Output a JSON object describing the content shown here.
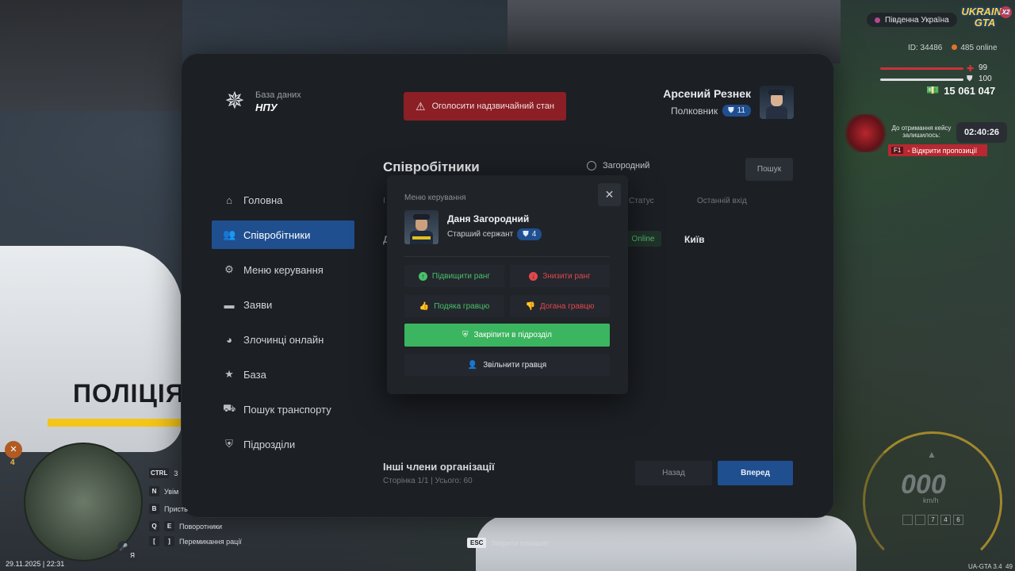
{
  "tablet": {
    "brand_sub": "База даних",
    "brand_title": "НПУ",
    "emergency_label": "Оголосити надзвичайний стан",
    "user": {
      "name": "Арсений Резнек",
      "rank": "Полковник",
      "rank_level": "11"
    }
  },
  "sidebar": {
    "items": [
      {
        "label": "Головна",
        "icon": "home-icon",
        "active": false
      },
      {
        "label": "Співробітники",
        "icon": "users-icon",
        "active": true
      },
      {
        "label": "Меню керування",
        "icon": "gear-icon",
        "active": false
      },
      {
        "label": "Заяви",
        "icon": "folder-icon",
        "active": false
      },
      {
        "label": "Злочинці онлайн",
        "icon": "mask-icon",
        "active": false
      },
      {
        "label": "База",
        "icon": "star-icon",
        "active": false
      },
      {
        "label": "Пошук транспорту",
        "icon": "car-icon",
        "active": false
      },
      {
        "label": "Підрозділи",
        "icon": "shield-icon",
        "active": false
      }
    ]
  },
  "content": {
    "title": "Співробітники",
    "search_value": "Загородний",
    "search_button": "Пошук",
    "columns": {
      "first": "І",
      "status": "Статус",
      "last_login": "Останній вхід"
    },
    "row": {
      "first": "Д",
      "status": "Online",
      "city": "Київ"
    },
    "other_title": "Інші члени організації",
    "other_sub": "Сторінка 1/1 | Усього: 60",
    "back_label": "Назад",
    "next_label": "Вперед"
  },
  "modal": {
    "label": "Меню керування",
    "name": "Даня Загородний",
    "rank": "Старший сержант",
    "rank_level": "4",
    "promote": "Підвищити ранг",
    "demote": "Знизити ранг",
    "thanks": "Подяка гравцю",
    "reprimand": "Догана гравцю",
    "assign": "Закріпити в підрозділ",
    "fire": "Звільнити гравця"
  },
  "hud": {
    "region": "Південна Україна",
    "logo": "UKRAINE GTA",
    "logo_badge": "X2",
    "player_id": "ID: 34486",
    "online": "485 online",
    "health": 99,
    "armor": 100,
    "money": "15 061 047",
    "case_text": "До отримання кейсу залишилось:",
    "case_timer": "02:40:26",
    "case_key": "F1",
    "case_action": "- Відкрити пропозиції",
    "speed": "000",
    "speed_unit": "km/h",
    "gears": [
      "",
      "",
      "7",
      "4",
      "6"
    ],
    "version": "UA-GTA 3.4",
    "version_extra": "49",
    "hints": [
      {
        "keys": [
          "CTRL"
        ],
        "label": "3"
      },
      {
        "keys": [
          "N"
        ],
        "label": "Увім"
      },
      {
        "keys": [
          "B"
        ],
        "label": "Присть"
      },
      {
        "keys": [
          "Q",
          "E"
        ],
        "label": "Поворотники"
      },
      {
        "keys": [
          "[",
          "]"
        ],
        "label": "Перемикання рації"
      }
    ],
    "esc_key": "ESC",
    "esc_label": "Закрити планшет",
    "datetime": "29.11.2025 | 22:31",
    "mic_label": "Я",
    "minimap_level": "4"
  },
  "background": {
    "car_text": "ПОЛІЦІЯ"
  }
}
